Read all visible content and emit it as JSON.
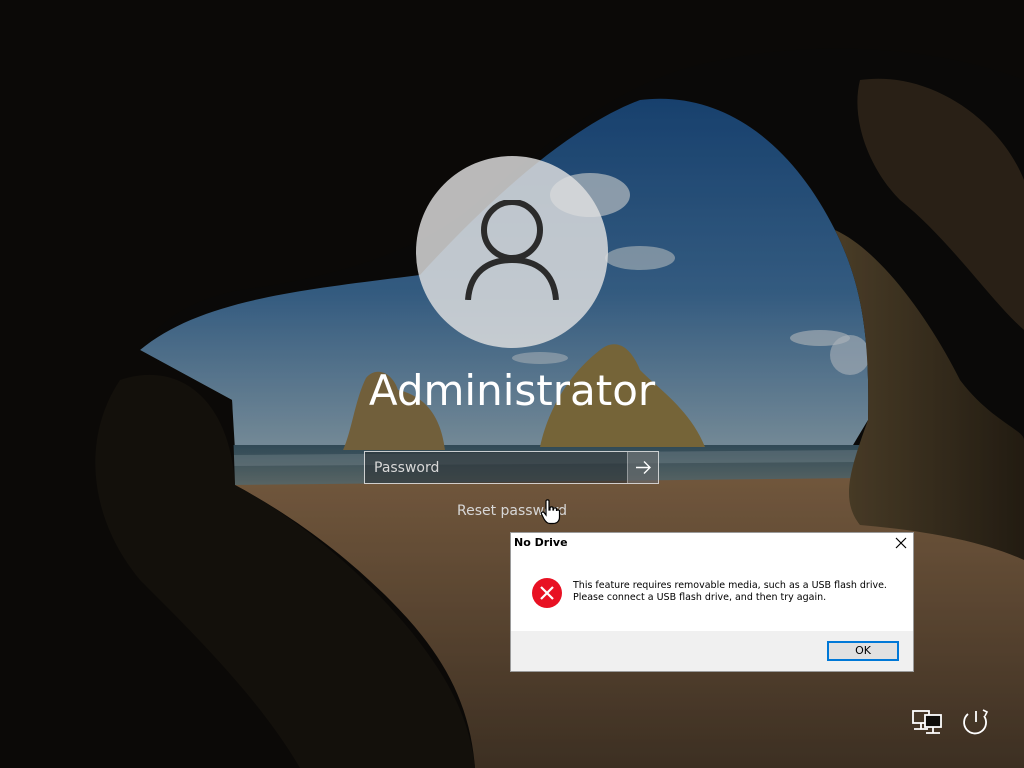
{
  "login": {
    "username": "Administrator",
    "password_placeholder": "Password",
    "submit_icon": "arrow-right-icon",
    "reset_link": "Reset password"
  },
  "dialog": {
    "title": "No Drive",
    "icon": "error-icon",
    "message_line1": "This feature requires removable media, such as a USB flash drive.",
    "message_line2": "Please connect a USB flash drive, and then try again.",
    "ok_label": "OK"
  },
  "system_icons": [
    "network-icon",
    "power-icon"
  ],
  "colors": {
    "error_red": "#e81123",
    "focus_blue": "#0078d7",
    "dialog_footer": "#f0f0f0"
  }
}
